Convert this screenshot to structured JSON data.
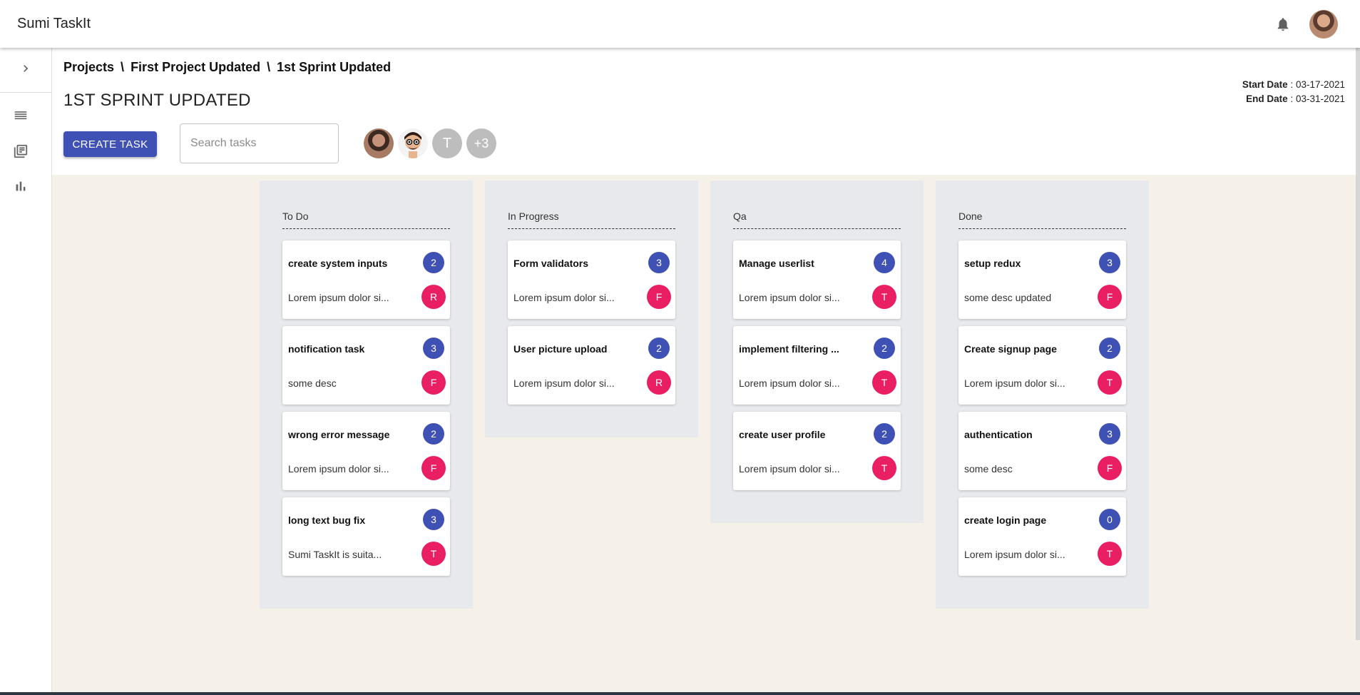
{
  "app": {
    "title": "Sumi TaskIt"
  },
  "icons": {
    "notifications": "bell-icon",
    "sidebar_toggle": "chevron-right-icon",
    "sidebar_items": [
      "list-icon",
      "library-books-icon",
      "bar-chart-icon"
    ]
  },
  "breadcrumb": [
    "Projects",
    "First Project Updated",
    "1st Sprint Updated"
  ],
  "breadcrumb_separator": "\\",
  "page_title": "1ST SPRINT UPDATED",
  "dates": {
    "start_label": "Start Date",
    "start_value": " : 03-17-2021",
    "end_label": "End Date",
    "end_value": " : 03-31-2021"
  },
  "toolbar": {
    "create_label": "CREATE TASK",
    "search_placeholder": "Search tasks"
  },
  "members": [
    "T",
    "+3"
  ],
  "colors": {
    "primary": "#3f51b5",
    "accent": "#e91e63",
    "board_bg": "#f5f1e9",
    "column_bg": "#e8e9ec"
  },
  "columns": [
    {
      "title": "To Do",
      "cards": [
        {
          "title": "create system inputs",
          "desc": "Lorem ipsum dolor si...",
          "points": "2",
          "assignee": "R"
        },
        {
          "title": "notification task",
          "desc": "some desc",
          "points": "3",
          "assignee": "F"
        },
        {
          "title": "wrong error message",
          "desc": "Lorem ipsum dolor si...",
          "points": "2",
          "assignee": "F"
        },
        {
          "title": "long text bug fix",
          "desc": "Sumi TaskIt is suita...",
          "points": "3",
          "assignee": "T"
        }
      ]
    },
    {
      "title": "In Progress",
      "cards": [
        {
          "title": "Form validators",
          "desc": "Lorem ipsum dolor si...",
          "points": "3",
          "assignee": "F"
        },
        {
          "title": "User picture upload",
          "desc": "Lorem ipsum dolor si...",
          "points": "2",
          "assignee": "R"
        }
      ]
    },
    {
      "title": "Qa",
      "cards": [
        {
          "title": "Manage userlist",
          "desc": "Lorem ipsum dolor si...",
          "points": "4",
          "assignee": "T"
        },
        {
          "title": "implement filtering ...",
          "desc": "Lorem ipsum dolor si...",
          "points": "2",
          "assignee": "T"
        },
        {
          "title": "create user profile",
          "desc": "Lorem ipsum dolor si...",
          "points": "2",
          "assignee": "T"
        }
      ]
    },
    {
      "title": "Done",
      "cards": [
        {
          "title": "setup redux",
          "desc": "some desc updated",
          "points": "3",
          "assignee": "F"
        },
        {
          "title": "Create signup page",
          "desc": "Lorem ipsum dolor si...",
          "points": "2",
          "assignee": "T"
        },
        {
          "title": "authentication",
          "desc": "some desc",
          "points": "3",
          "assignee": "F"
        },
        {
          "title": "create login page",
          "desc": "Lorem ipsum dolor si...",
          "points": "0",
          "assignee": "T"
        }
      ]
    }
  ]
}
